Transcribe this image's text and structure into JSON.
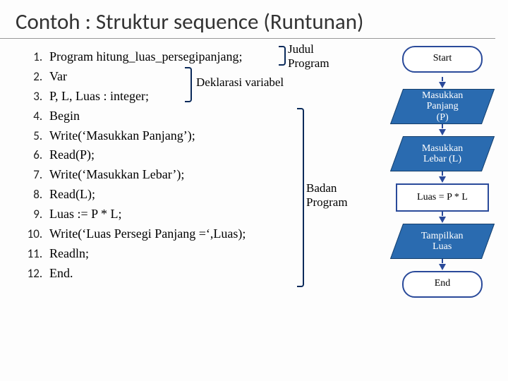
{
  "title": "Contoh : Struktur sequence  (Runtunan)",
  "code": {
    "l1": "Program hitung_luas_persegipanjang;",
    "l2": "Var",
    "l3": "P, L, Luas : integer;",
    "l4": "Begin",
    "l5": "Write(‘Masukkan Panjang’);",
    "l6": "Read(P);",
    "l7": "Write(‘Masukkan Lebar’);",
    "l8": "Read(L);",
    "l9": "Luas := P * L;",
    "l10": "Write(‘Luas Persegi Panjang =‘,Luas);",
    "l11": "Readln;",
    "l12": "End."
  },
  "annotations": {
    "judul": "Judul\nProgram",
    "deklarasi": "Deklarasi variabel",
    "badan": "Badan\nProgram"
  },
  "flow": {
    "start": "Start",
    "in_p": "Masukkan\nPanjang\n(P)",
    "in_l": "Masukkan\nLebar (L)",
    "proc": "Luas = P * L",
    "out": "Tampilkan\nLuas",
    "end": "End"
  }
}
